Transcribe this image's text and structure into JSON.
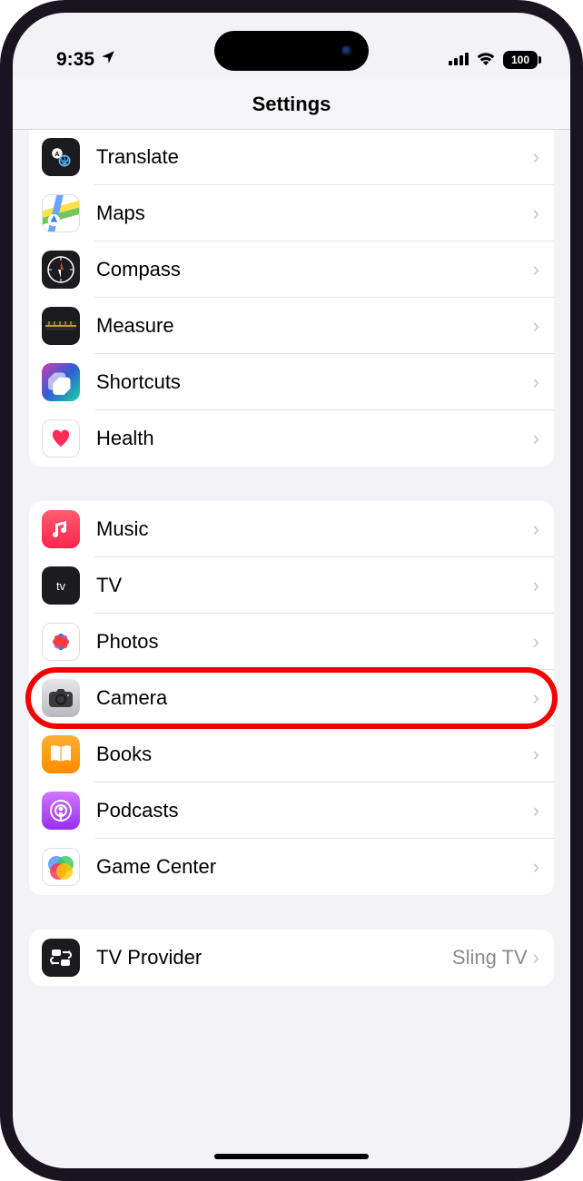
{
  "status": {
    "time": "9:35",
    "battery": "100"
  },
  "header": {
    "title": "Settings"
  },
  "groups": [
    {
      "items": [
        {
          "id": "translate",
          "label": "Translate",
          "icon": "translate"
        },
        {
          "id": "maps",
          "label": "Maps",
          "icon": "maps"
        },
        {
          "id": "compass",
          "label": "Compass",
          "icon": "compass"
        },
        {
          "id": "measure",
          "label": "Measure",
          "icon": "measure"
        },
        {
          "id": "shortcuts",
          "label": "Shortcuts",
          "icon": "shortcuts"
        },
        {
          "id": "health",
          "label": "Health",
          "icon": "health"
        }
      ]
    },
    {
      "items": [
        {
          "id": "music",
          "label": "Music",
          "icon": "music"
        },
        {
          "id": "tv",
          "label": "TV",
          "icon": "tv"
        },
        {
          "id": "photos",
          "label": "Photos",
          "icon": "photos"
        },
        {
          "id": "camera",
          "label": "Camera",
          "icon": "camera",
          "highlighted": true
        },
        {
          "id": "books",
          "label": "Books",
          "icon": "books"
        },
        {
          "id": "podcasts",
          "label": "Podcasts",
          "icon": "podcasts"
        },
        {
          "id": "gamecenter",
          "label": "Game Center",
          "icon": "gamecenter"
        }
      ]
    },
    {
      "items": [
        {
          "id": "tvprovider",
          "label": "TV Provider",
          "icon": "tvprovider",
          "detail": "Sling TV"
        }
      ]
    }
  ],
  "icons": {
    "translate": {
      "glyph": "svg-translate"
    },
    "maps": {
      "glyph": "svg-maps"
    },
    "compass": {
      "glyph": "svg-compass"
    },
    "measure": {
      "glyph": "svg-measure"
    },
    "shortcuts": {
      "glyph": "svg-shortcuts"
    },
    "health": {
      "glyph": "♥"
    },
    "music": {
      "glyph": "♫"
    },
    "tv": {
      "glyph": "tv"
    },
    "photos": {
      "glyph": "svg-photos"
    },
    "camera": {
      "glyph": "svg-camera"
    },
    "books": {
      "glyph": "svg-books"
    },
    "podcasts": {
      "glyph": "svg-podcasts"
    },
    "gamecenter": {
      "glyph": "svg-gamecenter"
    },
    "tvprovider": {
      "glyph": "svg-tvprovider"
    }
  }
}
